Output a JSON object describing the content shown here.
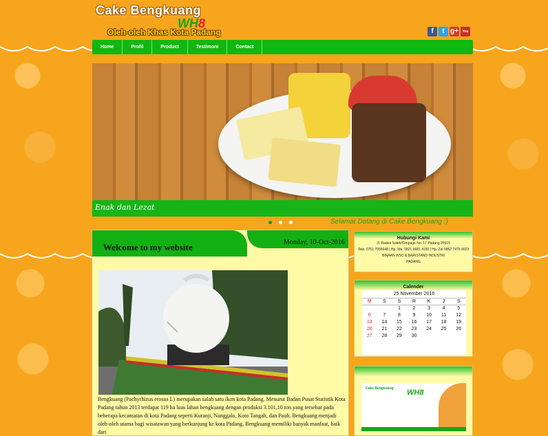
{
  "header": {
    "title": "Cake Bengkuang",
    "logo_main": "WH",
    "logo_accent": "8",
    "tagline": "Oleh-oleh Khas Kota Padang",
    "social": [
      {
        "name": "facebook-icon",
        "glyph": "f",
        "color": "#3b5998"
      },
      {
        "name": "twitter-icon",
        "glyph": "t",
        "color": "#2aa3ef"
      },
      {
        "name": "google-plus-icon",
        "glyph": "g+",
        "color": "#d23b2c"
      },
      {
        "name": "youtube-icon",
        "glyph": "You",
        "color": "#c4302b"
      }
    ]
  },
  "nav": [
    "Home",
    "Profil",
    "Product",
    "Testimoni",
    "Contact"
  ],
  "banner": {
    "caption": "Enak dan Lezat",
    "slides": 3,
    "active": 0
  },
  "marquee": "Selamat Datang di Cake Bengkuang :)",
  "main": {
    "title": "Welcome to my website",
    "date": "Monday, 10-Oct-2016",
    "body": "Bengkuang (Pachyrhizus erosus L) merupakan salah satu ikon kota Padang. Menurut Badan Pusat Statistik Kota Padang tahun 2013 terdapat 119 ha luas lahan bengkuang dengan produksi 3.101,10 ton yang tersebar pada beberapa kecamatan di kota Padang seperti Kuranji, Nanggalo, Koto Tangah, dan Pauh. Bengkuang menjadi oleh-oleh utama bagi wisatawan yang berkunjung ke kota Padang. Bengkuang memiliki banyak manfaat, baik dari"
  },
  "contact": {
    "title": "Hubungi Kami",
    "lines": [
      "Jl. Raden Saleh/Cimpago No. 17 Padang 25515",
      "Telp. 0751 7056648 | Hp. Wa. 0821 6681 4150 | Hp. Zul 0852 7475 9023",
      "BINAAN WSC & BARISTAND INDUSTRI",
      "PADANG"
    ]
  },
  "calendar": {
    "title": "Calender",
    "month": "25 November 2016",
    "headers": [
      "M",
      "S",
      "S",
      "R",
      "K",
      "J",
      "S"
    ],
    "weeks": [
      [
        "",
        "",
        "1",
        "2",
        "3",
        "4",
        "5"
      ],
      [
        "6",
        "7",
        "8",
        "9",
        "10",
        "11",
        "12"
      ],
      [
        "13",
        "14",
        "15",
        "16",
        "17",
        "18",
        "19"
      ],
      [
        "20",
        "21",
        "22",
        "23",
        "24",
        "25",
        "26"
      ],
      [
        "27",
        "28",
        "29",
        "30",
        "",
        "",
        ""
      ]
    ]
  },
  "ad": {
    "brand": "Cake Bengkuang",
    "logo": "WH8"
  }
}
